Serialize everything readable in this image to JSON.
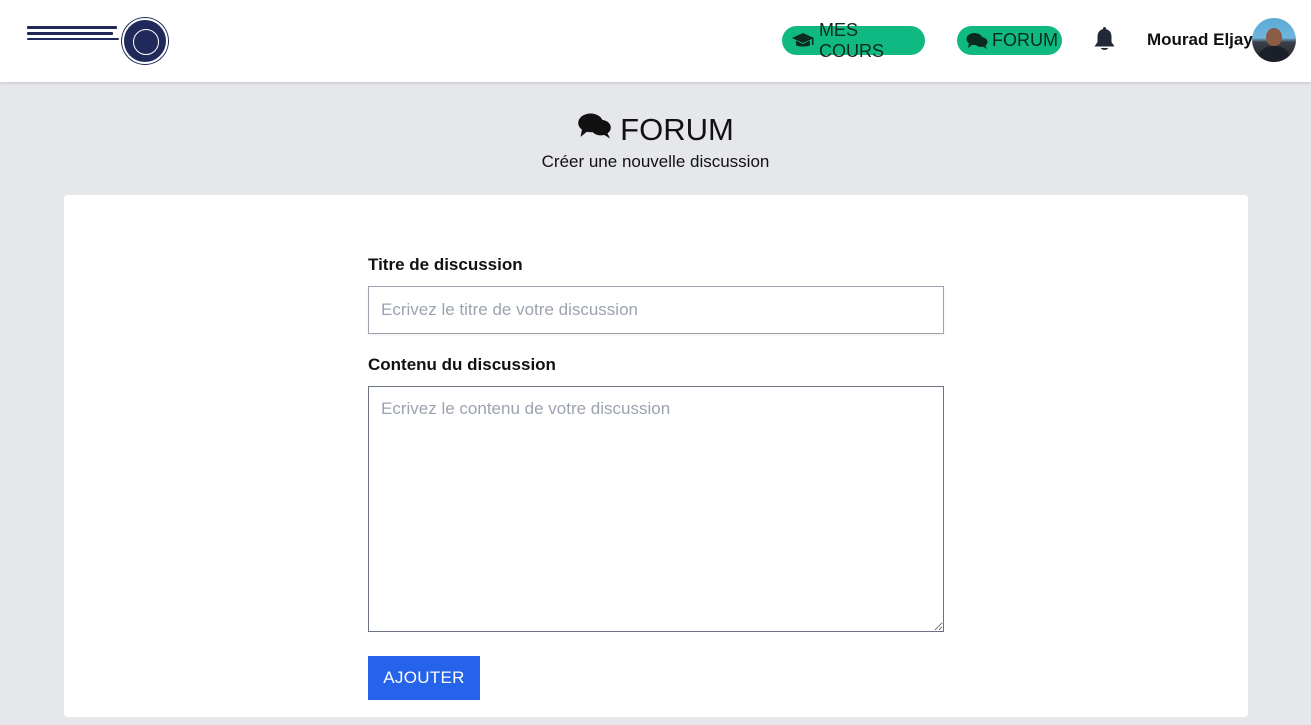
{
  "header": {
    "logo_alt": "Faculté Polydisciplinaire de Ouarzazate",
    "nav": {
      "courses_label": "MES COURS",
      "forum_label": "FORUM"
    },
    "username": "Mourad Eljayi"
  },
  "page": {
    "title": "FORUM",
    "subtitle": "Créer une nouvelle discussion"
  },
  "form": {
    "title_label": "Titre de discussion",
    "title_value": "",
    "title_placeholder": "Ecrivez le titre de votre discussion",
    "content_label": "Contenu du discussion",
    "content_value": "",
    "content_placeholder": "Ecrivez le contenu de votre discussion",
    "submit_label": "AJOUTER"
  },
  "colors": {
    "nav_pill": "#10b981",
    "submit_button": "#2563eb",
    "page_background": "#e5e7eb"
  },
  "icons": {
    "courses": "graduation-cap-icon",
    "forum": "comments-icon",
    "notifications": "bell-icon"
  }
}
